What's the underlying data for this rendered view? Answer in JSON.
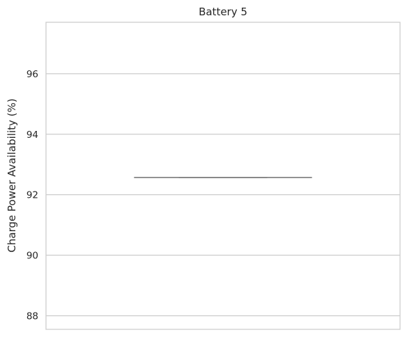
{
  "chart_data": {
    "type": "box",
    "title": "Battery 5",
    "xlabel": "",
    "ylabel": "Charge Power Availability (%)",
    "ylim": [
      87.55,
      97.7
    ],
    "yticks": [
      88,
      90,
      92,
      94,
      96
    ],
    "grid": true,
    "series": [
      {
        "min": 92.57,
        "q1": 92.57,
        "median": 92.57,
        "q3": 92.57,
        "max": 92.57
      }
    ],
    "colors": {
      "grid": "#cccccc",
      "frame": "#cccccc",
      "box": "#808080"
    }
  }
}
